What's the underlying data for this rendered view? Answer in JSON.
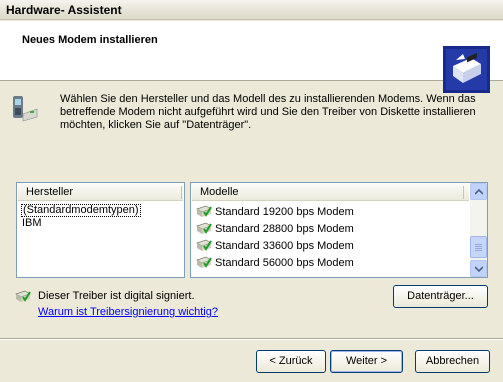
{
  "window": {
    "title": "Hardware- Assistent"
  },
  "header": {
    "title": "Neues Modem installieren",
    "icon": "hardware-wizard-icon"
  },
  "intro": {
    "text": "Wählen Sie den Hersteller und das Modell des zu installierenden Modems. Wenn das betreffende Modem nicht aufgeführt wird und Sie den Treiber von Diskette installieren möchten, klicken Sie auf \"Datenträger\".",
    "icon": "modem-phone-icon"
  },
  "manufacturers": {
    "header": "Hersteller",
    "items": [
      "(Standardmodemtypen)",
      "IBM"
    ],
    "selected": "(Standardmodemtypen)"
  },
  "models": {
    "header": "Modelle",
    "items": [
      "Standard 19200 bps Modem",
      "Standard 28800 bps Modem",
      "Standard 33600 bps Modem",
      "Standard 56000 bps Modem"
    ],
    "icon": "signed-driver-icon"
  },
  "signature": {
    "status": "Dieser Treiber ist digital signiert.",
    "link": "Warum ist Treibersignierung wichtig?"
  },
  "buttons": {
    "disk": "Datenträger...",
    "back": "< Zurück",
    "next": "Weiter >",
    "cancel": "Abbrechen"
  },
  "colors": {
    "background": "#ece9d8",
    "link": "#0000ff",
    "border": "#7f9db9"
  }
}
